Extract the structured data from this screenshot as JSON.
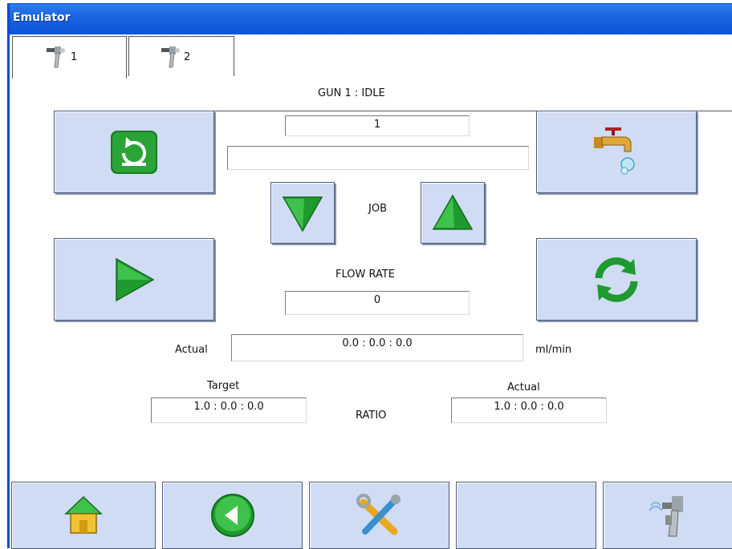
{
  "window": {
    "title": "Emulator"
  },
  "tabs": [
    {
      "label": "1",
      "icon": "spray-gun-icon",
      "active": true
    },
    {
      "label": "2",
      "icon": "spray-gun-icon",
      "active": false
    }
  ],
  "gun": {
    "status": "GUN 1 : IDLE",
    "job_number": "1",
    "job_name": "",
    "job_label": "JOB"
  },
  "flow": {
    "label": "FLOW RATE",
    "value": "0",
    "actual_label": "Actual",
    "actual_value": "0.0 : 0.0 : 0.0",
    "unit": "ml/min"
  },
  "ratio": {
    "label": "RATIO",
    "target_label": "Target",
    "target_value": "1.0 : 0.0 : 0.0",
    "actual_label": "Actual",
    "actual_value": "1.0 : 0.0 : 0.0"
  },
  "buttons": {
    "reset": "reset-icon",
    "tap": "water-tap-icon",
    "play": "play-icon",
    "refresh": "refresh-icon",
    "job_down": "triangle-down-icon",
    "job_up": "triangle-up-icon"
  },
  "footer": [
    {
      "name": "home-button",
      "icon": "home-icon"
    },
    {
      "name": "back-button",
      "icon": "back-arrow-icon"
    },
    {
      "name": "tools-button",
      "icon": "tools-icon"
    },
    {
      "name": "blank-button",
      "icon": ""
    },
    {
      "name": "spray-gun-button",
      "icon": "spray-gun-icon"
    }
  ],
  "colors": {
    "titlebar": "#0b54d8",
    "button_face": "#cfdcf3",
    "icon_green": "#1f9a2e"
  }
}
